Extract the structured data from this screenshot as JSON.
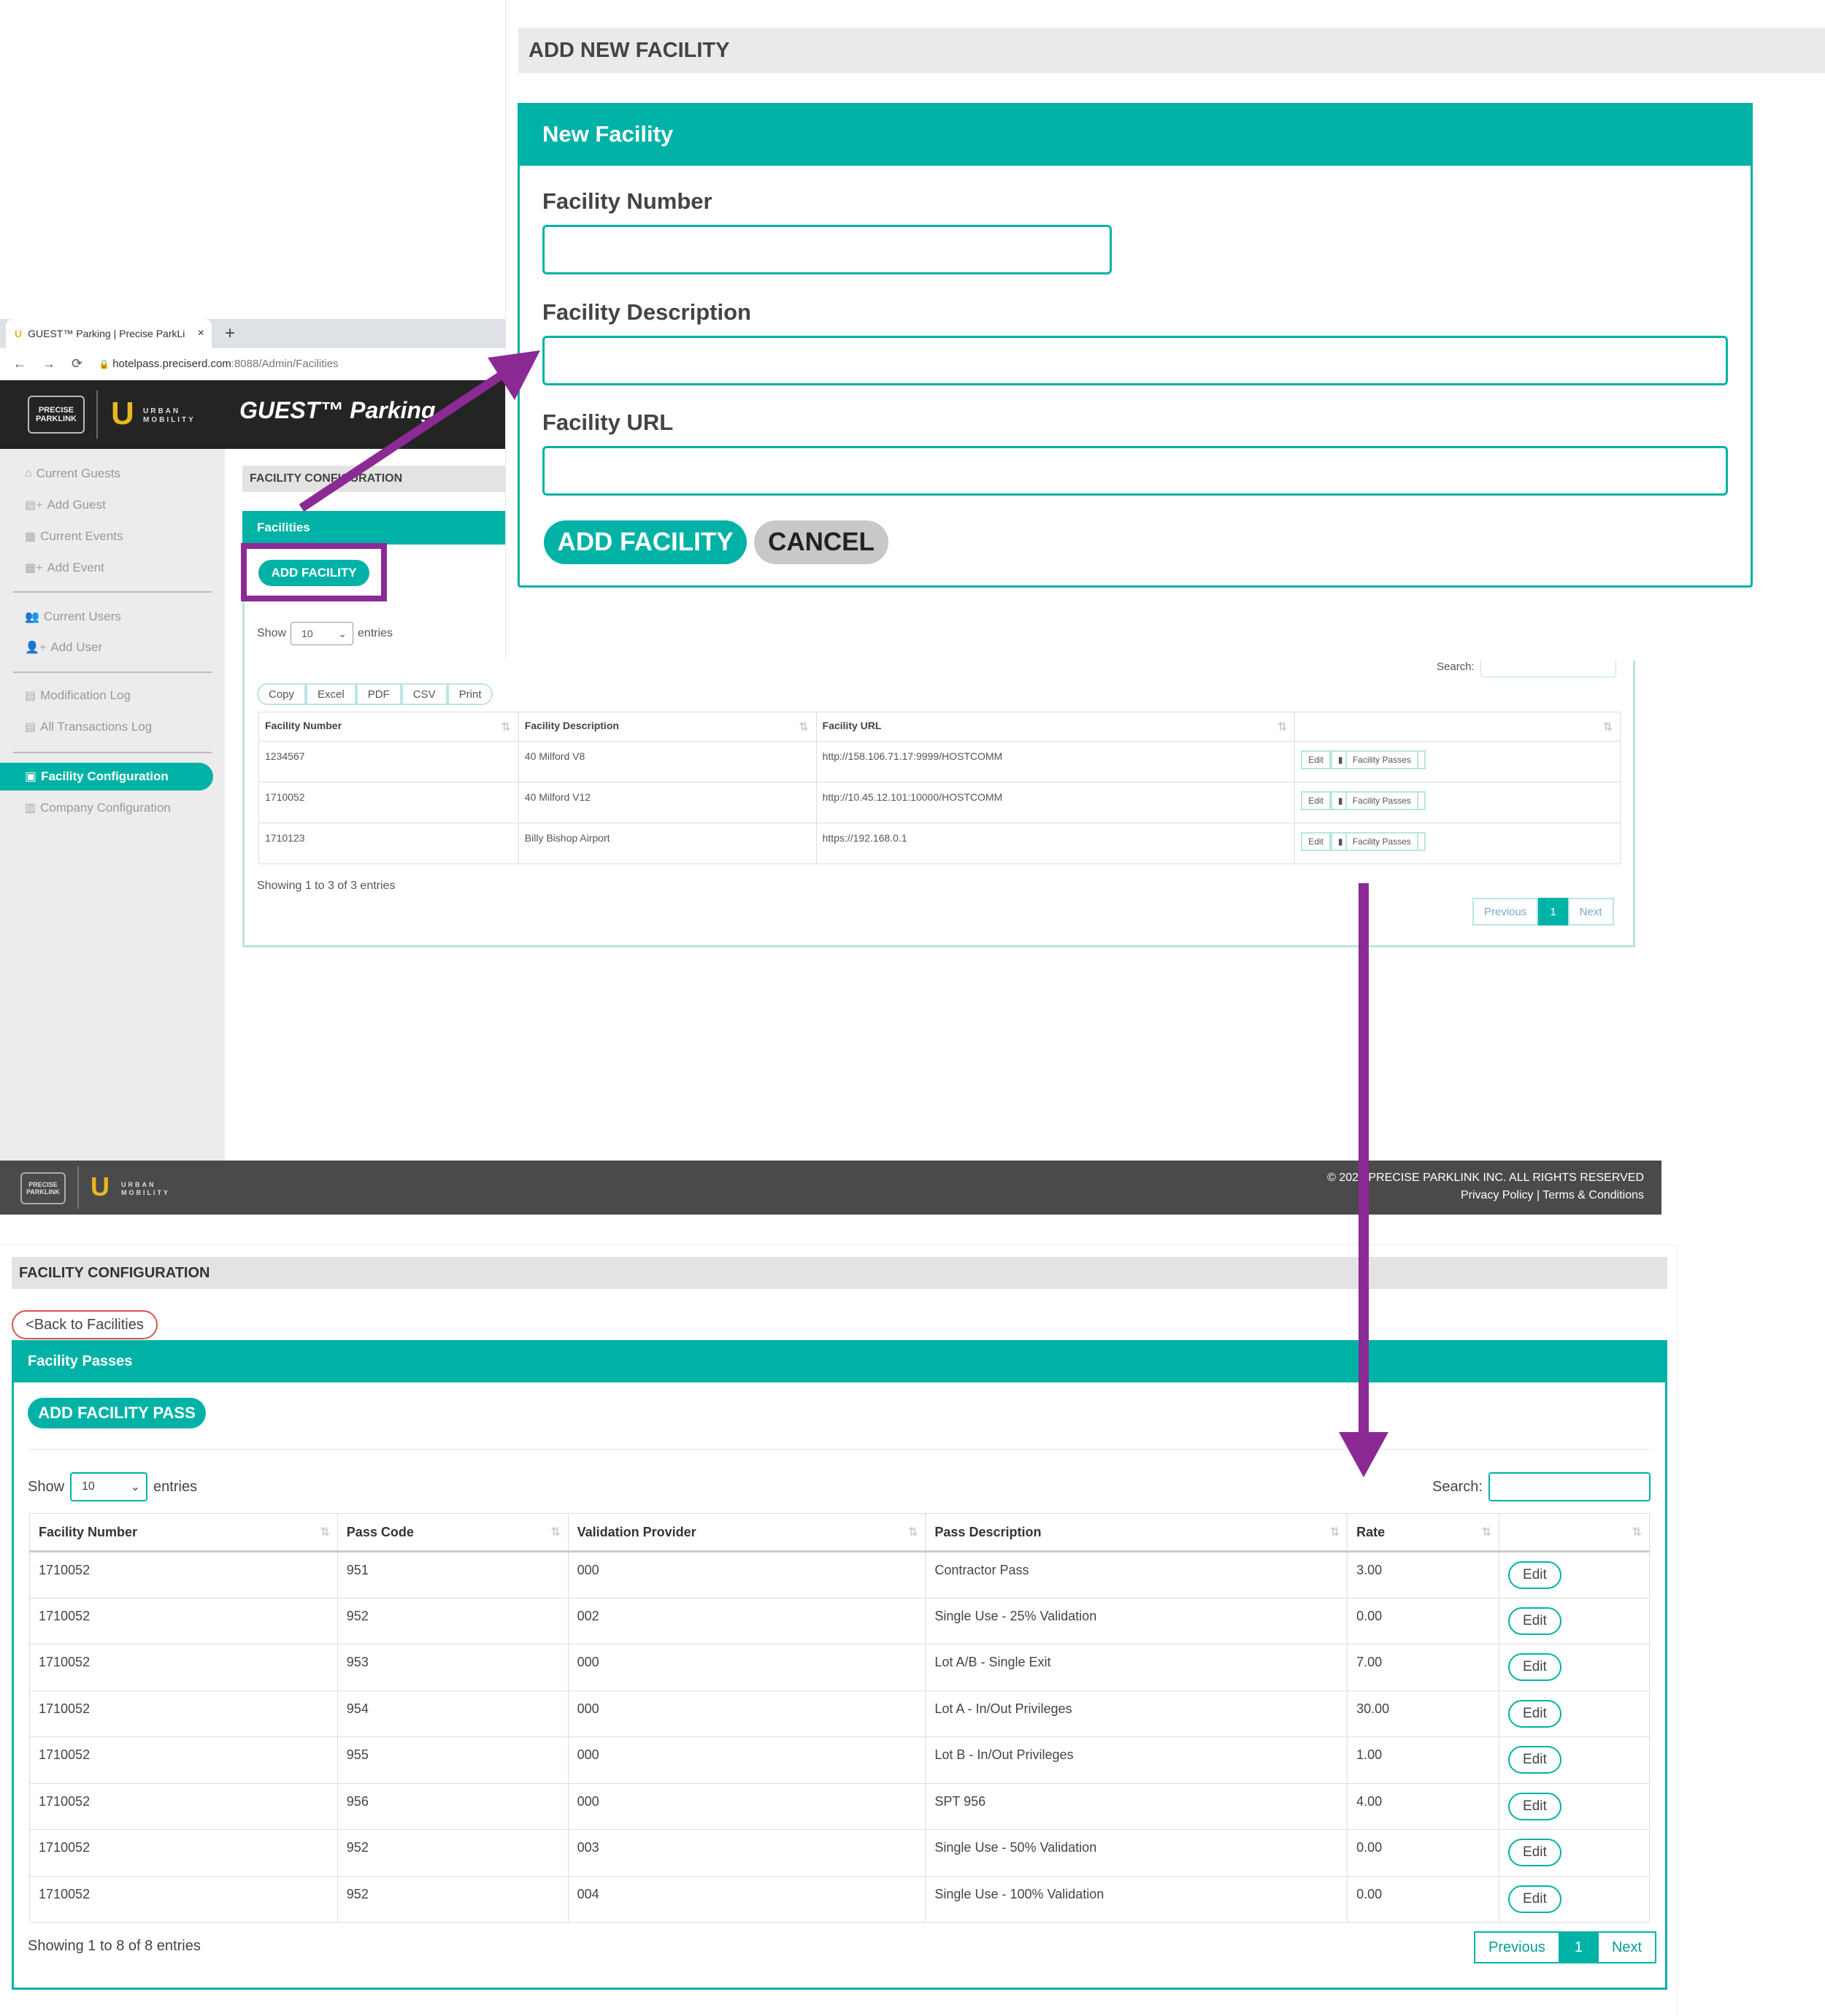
{
  "browser": {
    "tab_title": "GUEST™ Parking | Precise ParkLi",
    "tab_close": "×",
    "new_tab": "+",
    "url_host": "hotelpass.preciserd.com",
    "url_path": ":8088/Admin/Facilities",
    "back": "←",
    "forward": "→",
    "reload": "⟳",
    "lock": "🔒"
  },
  "app": {
    "title": "GUEST™ Parking",
    "logo_precise": "PRECISE PARKLINK",
    "logo_u": "U",
    "logo_urban": "URBAN MOBILITY"
  },
  "sidebar": {
    "items": [
      {
        "icon": "⌂",
        "label": "Current Guests"
      },
      {
        "icon": "▤+",
        "label": "Add Guest"
      },
      {
        "icon": "▦",
        "label": "Current Events"
      },
      {
        "icon": "▦+",
        "label": "Add Event"
      },
      {
        "icon": "👥",
        "label": "Current Users"
      },
      {
        "icon": "👤+",
        "label": "Add User"
      },
      {
        "icon": "▤",
        "label": "Modification Log"
      },
      {
        "icon": "▤",
        "label": "All Transactions Log"
      },
      {
        "icon": "▣",
        "label": "Facility Configuration"
      },
      {
        "icon": "▥",
        "label": "Company Configuration"
      }
    ]
  },
  "facility_config": {
    "title": "FACILITY CONFIGURATION",
    "panel_title": "Facilities",
    "add_button": "ADD FACILITY",
    "show_label": "Show",
    "entries_label": "entries",
    "page_size": "10",
    "search_label": "Search:",
    "export_buttons": [
      "Copy",
      "Excel",
      "PDF",
      "CSV",
      "Print"
    ],
    "columns": [
      "Facility Number",
      "Facility Description",
      "Facility URL",
      ""
    ],
    "rows": [
      {
        "number": "1234567",
        "description": "40 Milford V8",
        "url": "http://158.106.71.17:9999/HOSTCOMM"
      },
      {
        "number": "1710052",
        "description": "40 Milford V12",
        "url": "http://10.45.12.101:10000/HOSTCOMM"
      },
      {
        "number": "1710123",
        "description": "Billy Bishop Airport",
        "url": "https://192.168.0.1"
      }
    ],
    "edit_label": "Edit",
    "passes_label": "Facility Passes",
    "showing": "Showing 1 to 3 of 3 entries",
    "prev": "Previous",
    "page": "1",
    "next": "Next"
  },
  "footer": {
    "copyright": "© 2020 PRECISE PARKLINK INC. ALL RIGHTS RESERVED",
    "privacy": "Privacy Policy",
    "sep": "|",
    "terms": "Terms & Conditions"
  },
  "modal": {
    "page_title": "ADD NEW FACILITY",
    "card_title": "New Facility",
    "label_number": "Facility Number",
    "label_description": "Facility Description",
    "label_url": "Facility URL",
    "value_number": "",
    "value_description": "",
    "value_url": "",
    "add_button": "ADD FACILITY",
    "cancel_button": "CANCEL"
  },
  "passes": {
    "config_title": "FACILITY CONFIGURATION",
    "back_link": "<Back to Facilities",
    "panel_title": "Facility Passes",
    "add_button": "ADD FACILITY PASS",
    "show_label": "Show",
    "entries_label": "entries",
    "page_size": "10",
    "search_label": "Search:",
    "columns": [
      "Facility Number",
      "Pass Code",
      "Validation Provider",
      "Pass Description",
      "Rate",
      ""
    ],
    "rows": [
      {
        "facility": "1710052",
        "code": "951",
        "provider": "000",
        "description": "Contractor Pass",
        "rate": "3.00"
      },
      {
        "facility": "1710052",
        "code": "952",
        "provider": "002",
        "description": "Single Use - 25% Validation",
        "rate": "0.00"
      },
      {
        "facility": "1710052",
        "code": "953",
        "provider": "000",
        "description": "Lot A/B - Single Exit",
        "rate": "7.00"
      },
      {
        "facility": "1710052",
        "code": "954",
        "provider": "000",
        "description": "Lot A - In/Out Privileges",
        "rate": "30.00"
      },
      {
        "facility": "1710052",
        "code": "955",
        "provider": "000",
        "description": "Lot B - In/Out Privileges",
        "rate": "1.00"
      },
      {
        "facility": "1710052",
        "code": "956",
        "provider": "000",
        "description": "SPT 956",
        "rate": "4.00"
      },
      {
        "facility": "1710052",
        "code": "952",
        "provider": "003",
        "description": "Single Use - 50% Validation",
        "rate": "0.00"
      },
      {
        "facility": "1710052",
        "code": "952",
        "provider": "004",
        "description": "Single Use - 100% Validation",
        "rate": "0.00"
      }
    ],
    "edit_label": "Edit",
    "showing": "Showing 1 to 8 of 8 entries",
    "prev": "Previous",
    "page": "1",
    "next": "Next"
  },
  "colors": {
    "teal": "#00b2a6",
    "highlight": "#8b2a94",
    "header_dark": "#242424"
  }
}
